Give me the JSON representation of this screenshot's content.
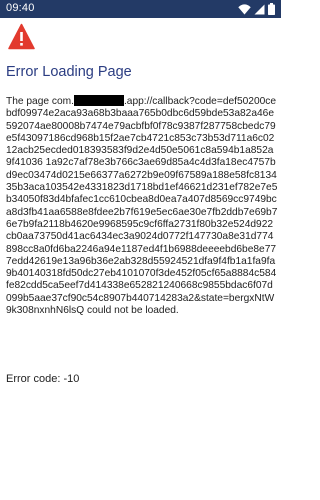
{
  "status_bar": {
    "time": "09:40",
    "icons": [
      "wifi-icon",
      "signal-icon",
      "battery-icon"
    ],
    "background_color": "#233a66"
  },
  "error_icon": {
    "name": "warning-triangle-icon",
    "color": "#e23a2e"
  },
  "title": "Error Loading Page",
  "title_color": "#2b3d82",
  "message": {
    "prefix": "The page ",
    "host_start": "com.",
    "host_end": ".app://callback?code=",
    "url_body": "def50200cebdf09974e2aca93a68b3baaa765b0dbc6d59bde53a82a46e592074ae80008b7474e79acbfbf0f78c9387f287758cbedc79e5f43097186cd968b15f2ae7cb4721c853c73b53d711a6c0212acb25ecded018393583f9d2e4d50e5061c8a594b1a852a9f41036 1a92c7af78e3b766c3ae69d85a4c4d3fa18ec4757bd9ec03474d0215e66377a6272b9e09f67589a188e58fc813435b3aca103542e4331823d1718bd1ef46621d231ef782e7e5b34050f83d4bfafec1cc610cbea8d0ea7a407d8569cc9749bca8d3fb41aa6588e8fdee2b7f619e5ec6ae30e7fb2ddb7e69b76e7b9fa2118b4620e9968595c9cf6ffa2731f80b32e524d922cb0aa73750d41ac6434ec3a9024d0772f147730a8e31d774898cc8a0fd6ba2246a94e1187ed4f1b6988deeeebd6be8e777edd42619e13a96b36e2ab328d55924521dfa9f4fb1a1fa9fa9b40140318fd50dc27eb4101070f3de452f05cf65a8884c584fe82cdd5ca5eef7d414338e652821240668c9855bdac6f07d099b5aae37cf90c54c8907b440714283a2&state=bergxNtW9k308nxnhN6lsQ",
    "suffix": " could not be loaded."
  },
  "error_code": "Error code: -10"
}
